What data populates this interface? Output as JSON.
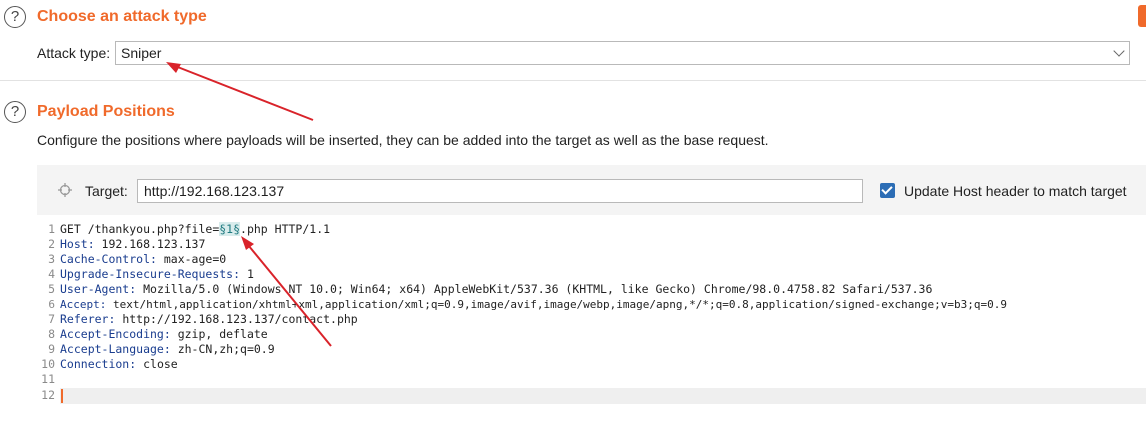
{
  "attack": {
    "title": "Choose an attack type",
    "type_label": "Attack type:",
    "type_value": "Sniper"
  },
  "payload": {
    "title": "Payload Positions",
    "description": "Configure the positions where payloads will be inserted, they can be added into the target as well as the base request.",
    "target_label": "Target:",
    "target_value": "http://192.168.123.137",
    "update_host_label": "Update Host header to match target",
    "update_host_checked": true
  },
  "request_lines": [
    {
      "n": "1",
      "pre": "GET /thankyou.php?file=",
      "marker": "§1§",
      "post": ".php HTTP/1.1"
    },
    {
      "n": "2",
      "key": "Host:",
      "value": " 192.168.123.137"
    },
    {
      "n": "3",
      "key": "Cache-Control:",
      "value": " max-age=0"
    },
    {
      "n": "4",
      "key": "Upgrade-Insecure-Requests:",
      "value": " 1"
    },
    {
      "n": "5",
      "key": "User-Agent:",
      "value": " Mozilla/5.0 (Windows NT 10.0; Win64; x64) AppleWebKit/537.36 (KHTML, like Gecko) Chrome/98.0.4758.82 Safari/537.36"
    },
    {
      "n": "6",
      "key": "Accept:",
      "value": " text/html,application/xhtml+xml,application/xml;q=0.9,image/avif,image/webp,image/apng,*/*;q=0.8,application/signed-exchange;v=b3;q=0.9"
    },
    {
      "n": "7",
      "key": "Referer:",
      "value": " http://192.168.123.137/contact.php"
    },
    {
      "n": "8",
      "key": "Accept-Encoding:",
      "value": " gzip, deflate"
    },
    {
      "n": "9",
      "key": "Accept-Language:",
      "value": " zh-CN,zh;q=0.9"
    },
    {
      "n": "10",
      "key": "Connection:",
      "value": " close"
    },
    {
      "n": "11",
      "key": "",
      "value": ""
    },
    {
      "n": "12",
      "key": "",
      "value": ""
    }
  ],
  "colors": {
    "accent": "#f06a2b",
    "annotation_arrow": "#d9232a",
    "header_key": "#1a3d8f",
    "checkbox": "#2c6db5"
  }
}
